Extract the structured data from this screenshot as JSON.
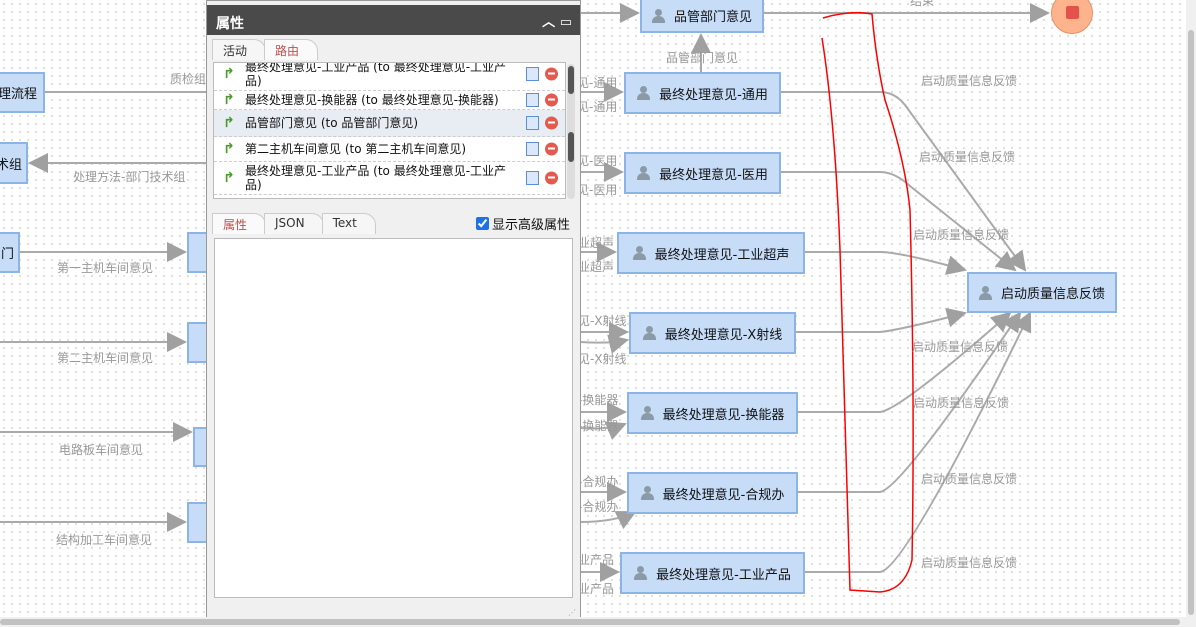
{
  "canvas": {
    "nodes": {
      "pinguan": "品管部门意见",
      "tongyong": "最终处理意见-通用",
      "yiyong": "最终处理意见-医用",
      "gongyechaosheng": "最终处理意见-工业超声",
      "xshexian": "最终处理意见-X射线",
      "huannengqi": "最终处理意见-换能器",
      "heguiban": "最终处理意见-合规办",
      "gongyechanpin": "最终处理意见-工业产品",
      "feedback": "启动质量信息反馈",
      "left_liucheng": "理流程",
      "left_jishuzu": "术组",
      "left_bumen": "门"
    },
    "edge_labels": {
      "end": "结束",
      "pinguan": "品管部门意见",
      "feedback": "启动质量信息反馈",
      "zhijian": "质检组",
      "jishuzu": "处理方法-部门技术组",
      "zhuji1": "第一主机车间意见",
      "zhuji2": "第二主机车间意见",
      "dianluban": "电路板车间意见",
      "jiegou": "结构加工车间意见",
      "tongyong": "见-通用",
      "yiyong": "见-医用",
      "chaosheng": "业超声",
      "xshexian": "见-X射线",
      "huannengqi": "-换能器",
      "heguiban": "-合规办",
      "chanpin": "业产品"
    }
  },
  "panel": {
    "title": "属性",
    "tabs": [
      "活动",
      "路由"
    ],
    "routes": [
      "最终处理意见-工业产品 (to 最终处理意见-工业产品)",
      "最终处理意见-换能器 (to 最终处理意见-换能器)",
      "品管部门意见 (to 品管部门意见)",
      "第二主机车间意见 (to 第二主机车间意见)",
      "最终处理意见-工业产品 (to 最终处理意见-工业产品)"
    ],
    "bottom_tabs": [
      "属性",
      "JSON",
      "Text"
    ],
    "show_advanced_label": "显示高级属性",
    "show_advanced_checked": true
  },
  "colors": {
    "node_fill": "#c6dcf7",
    "node_border": "#8db4e6",
    "edge": "#aaaaaa",
    "annotation": "#ff0000"
  }
}
